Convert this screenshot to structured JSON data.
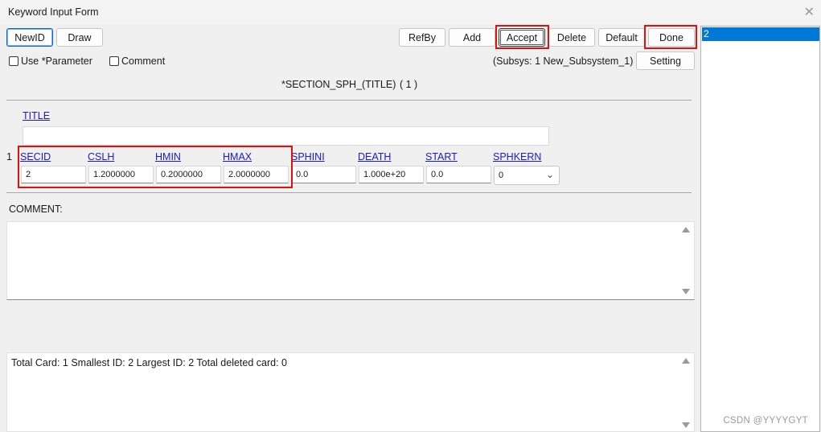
{
  "window": {
    "title": "Keyword Input Form",
    "close_glyph": "✕"
  },
  "toolbar": {
    "newid": "NewID",
    "draw": "Draw",
    "refby": "RefBy",
    "add": "Add",
    "accept": "Accept",
    "delete": "Delete",
    "default": "Default",
    "done": "Done",
    "setting": "Setting"
  },
  "options": {
    "use_parameter": "Use *Parameter",
    "comment": "Comment",
    "subsys": "(Subsys: 1 New_Subsystem_1)"
  },
  "keyword": {
    "heading": "*SECTION_SPH_(TITLE)",
    "count": "( 1 )"
  },
  "title_field": {
    "label": "TITLE",
    "value": ""
  },
  "card": {
    "row_number": "1",
    "fields": [
      {
        "label": "SECID",
        "value": "2"
      },
      {
        "label": "CSLH",
        "value": "1.2000000"
      },
      {
        "label": "HMIN",
        "value": "0.2000000"
      },
      {
        "label": "HMAX",
        "value": "2.0000000"
      },
      {
        "label": "SPHINI",
        "value": "0.0"
      },
      {
        "label": "DEATH",
        "value": "1.000e+20"
      },
      {
        "label": "START",
        "value": "0.0"
      },
      {
        "label": "SPHKERN",
        "value": "0"
      }
    ]
  },
  "comment_section": {
    "label": "COMMENT:",
    "value": ""
  },
  "status": {
    "text": "Total Card: 1    Smallest ID: 2    Largest ID: 2    Total deleted card:  0"
  },
  "id_list": {
    "items": [
      "2"
    ],
    "selected": "2"
  },
  "watermark": "CSDN @YYYYGYT",
  "colors": {
    "highlight": "#e01010",
    "selection": "#0078d7",
    "link": "#1a1acc"
  }
}
